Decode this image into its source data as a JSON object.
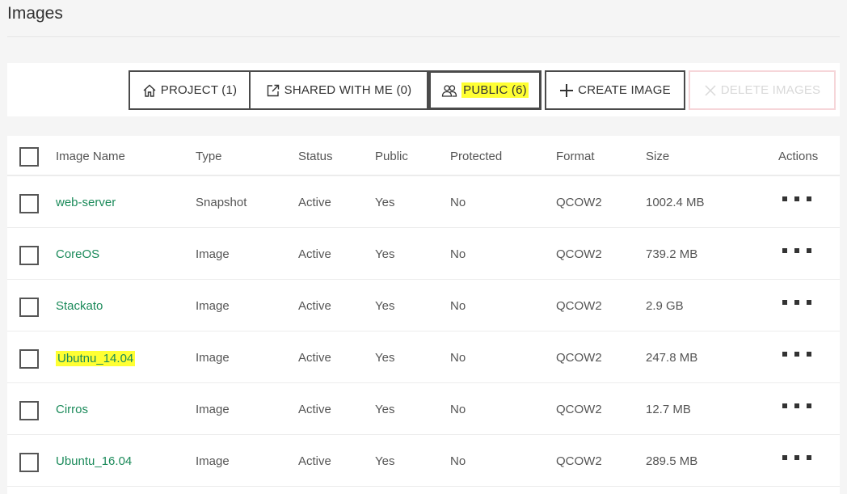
{
  "page": {
    "title": "Images"
  },
  "toolbar": {
    "filters": [
      {
        "label": "PROJECT (1)",
        "icon": "home-icon"
      },
      {
        "label": "SHARED WITH ME (0)",
        "icon": "external-link-icon"
      },
      {
        "label": "PUBLIC (6)",
        "icon": "users-icon",
        "selected": true
      }
    ],
    "create_label": "CREATE IMAGE",
    "create_icon": "plus-icon",
    "delete_label": "DELETE IMAGES",
    "delete_icon": "close-icon",
    "delete_enabled": false
  },
  "table": {
    "columns": [
      "Image Name",
      "Type",
      "Status",
      "Public",
      "Protected",
      "Format",
      "Size",
      "Actions"
    ],
    "rows": [
      {
        "name": "web-server",
        "type": "Snapshot",
        "status": "Active",
        "public": "Yes",
        "protected": "No",
        "format": "QCOW2",
        "size": "1002.4 MB"
      },
      {
        "name": "CoreOS",
        "type": "Image",
        "status": "Active",
        "public": "Yes",
        "protected": "No",
        "format": "QCOW2",
        "size": "739.2 MB"
      },
      {
        "name": "Stackato",
        "type": "Image",
        "status": "Active",
        "public": "Yes",
        "protected": "No",
        "format": "QCOW2",
        "size": "2.9 GB"
      },
      {
        "name": "Ubutnu_14.04",
        "type": "Image",
        "status": "Active",
        "public": "Yes",
        "protected": "No",
        "format": "QCOW2",
        "size": "247.8 MB",
        "highlighted": true
      },
      {
        "name": "Cirros",
        "type": "Image",
        "status": "Active",
        "public": "Yes",
        "protected": "No",
        "format": "QCOW2",
        "size": "12.7 MB"
      },
      {
        "name": "Ubuntu_16.04",
        "type": "Image",
        "status": "Active",
        "public": "Yes",
        "protected": "No",
        "format": "QCOW2",
        "size": "289.5 MB"
      }
    ]
  },
  "colors": {
    "link": "#1b8a5a",
    "highlight": "#ffff33",
    "border": "#4a4a4a",
    "delete_border": "#f6d6d9"
  }
}
